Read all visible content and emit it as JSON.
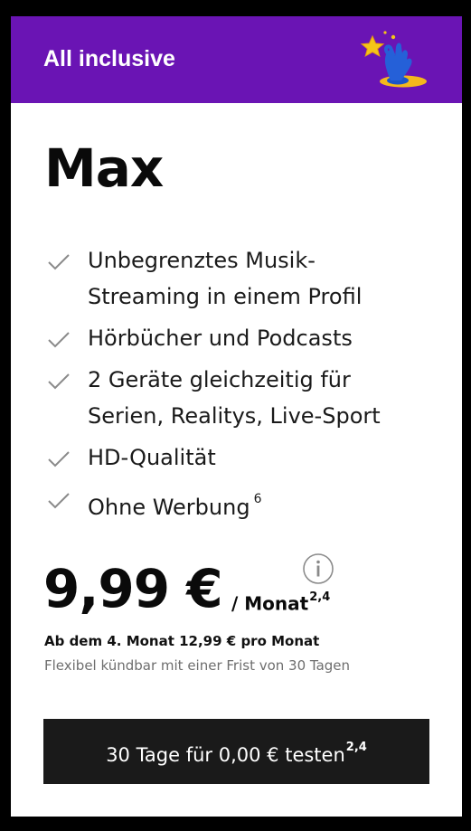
{
  "banner": {
    "title": "All inclusive",
    "logo_icon": "star-hand-icon",
    "background_color": "#6a14b4"
  },
  "plan": {
    "name": "Max"
  },
  "features": [
    {
      "lines": [
        "Unbegrenztes Musik-",
        "Streaming in einem Profil"
      ],
      "icon": "check-icon"
    },
    {
      "lines": [
        "Hörbücher und Podcasts"
      ],
      "icon": "check-icon"
    },
    {
      "lines": [
        "2 Geräte gleichzeitig für",
        "Serien, Realitys, Live-Sport"
      ],
      "icon": "check-icon"
    },
    {
      "lines": [
        "HD-Qualität"
      ],
      "icon": "check-icon"
    },
    {
      "lines": [
        "Ohne Werbung"
      ],
      "footnote": "6",
      "icon": "check-icon"
    }
  ],
  "pricing": {
    "price": "9,99 €",
    "unit": "/ Monat",
    "unit_footnote": "2,4",
    "info_icon": "info-icon",
    "after_note": "Ab dem 4. Monat 12,99 € pro Monat",
    "cancel_note": "Flexibel kündbar mit einer Frist von 30 Tagen"
  },
  "cta": {
    "label": "30 Tage für 0,00 € testen",
    "footnote": "2,4",
    "background_color": "#1a1a1a"
  }
}
